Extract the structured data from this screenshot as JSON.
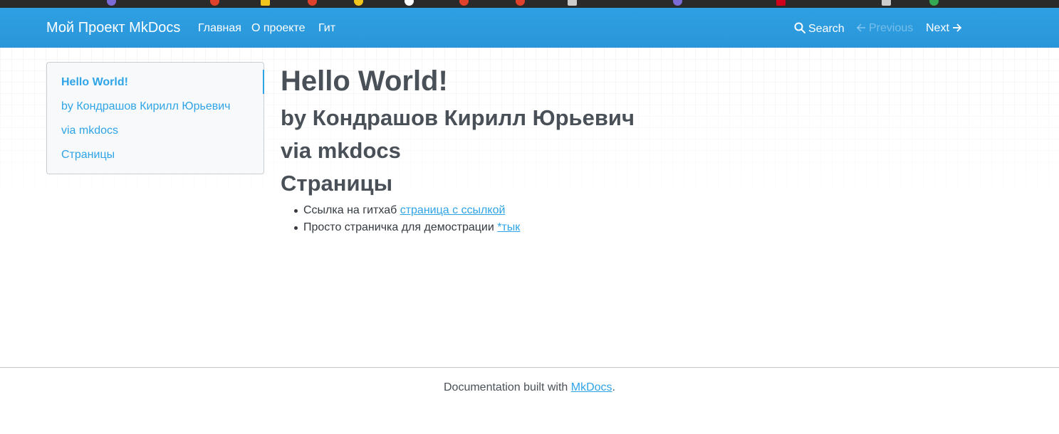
{
  "navbar": {
    "brand": "Мой Проект MkDocs",
    "links": [
      "Главная",
      "О проекте",
      "Гит"
    ],
    "search_label": "Search",
    "previous_label": "Previous",
    "next_label": "Next",
    "colors": {
      "background": "#2a96d9",
      "text": "#ffffff"
    }
  },
  "toc": {
    "items": [
      {
        "label": "Hello World!",
        "active": true
      },
      {
        "label": "by Кондрашов Кирилл Юрьевич",
        "active": false
      },
      {
        "label": "via mkdocs",
        "active": false
      },
      {
        "label": "Страницы",
        "active": false
      }
    ],
    "accent_color": "#2fa4e7"
  },
  "main": {
    "title": "Hello World!",
    "subheadings": [
      "by Кондрашов Кирилл Юрьевич",
      "via mkdocs",
      "Страницы"
    ],
    "list": [
      {
        "text": "Ссылка на гитхаб",
        "link": "страница с ссылкой"
      },
      {
        "text": "Просто страничка для демострации",
        "link": "*тык"
      }
    ]
  },
  "footer": {
    "prefix": "Documentation built with",
    "link": "MkDocs",
    "suffix": "."
  }
}
